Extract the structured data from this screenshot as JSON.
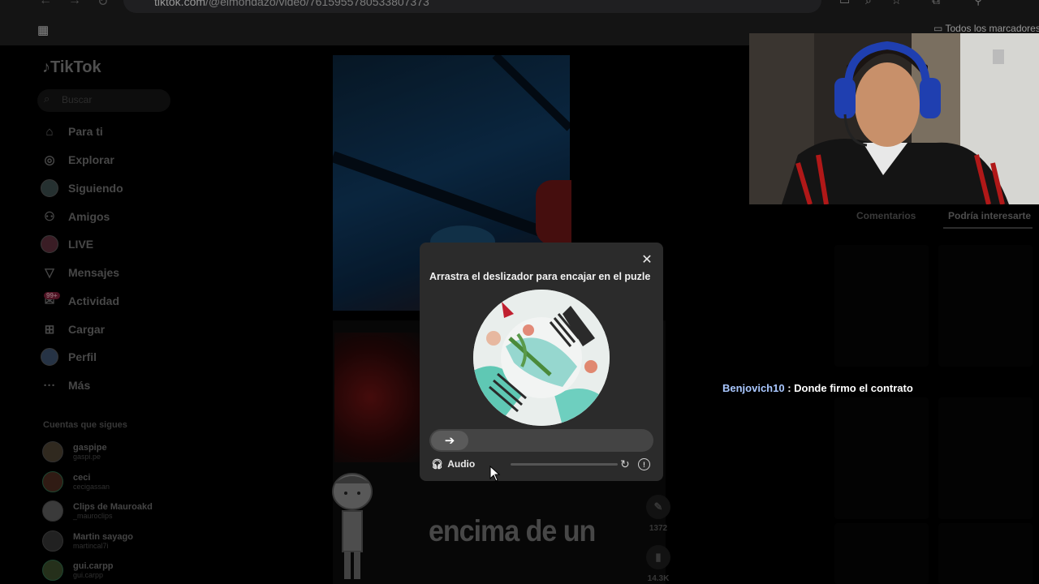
{
  "browser": {
    "url_host": "tiktok.com",
    "url_path": "/@elmondazo/video/7615955780533807373",
    "bookmarks_label": "Todos los marcadores"
  },
  "sidebar": {
    "logo": "TikTok",
    "search_placeholder": "Buscar",
    "items": [
      {
        "label": "Para ti",
        "icon": "home-icon"
      },
      {
        "label": "Explorar",
        "icon": "compass-icon"
      },
      {
        "label": "Siguiendo",
        "icon": "following-avatar"
      },
      {
        "label": "Amigos",
        "icon": "friends-icon"
      },
      {
        "label": "LIVE",
        "icon": "live-icon"
      },
      {
        "label": "Mensajes",
        "icon": "messages-icon"
      },
      {
        "label": "Actividad",
        "icon": "activity-icon"
      },
      {
        "label": "Cargar",
        "icon": "upload-icon"
      },
      {
        "label": "Perfil",
        "icon": "profile-avatar"
      },
      {
        "label": "Más",
        "icon": "more-icon"
      }
    ],
    "activity_badge": "99+",
    "following_title": "Cuentas que sigues",
    "accounts": [
      {
        "name": "gaspipe",
        "handle": "gaspi.pe"
      },
      {
        "name": "ceci",
        "handle": "cecigassan"
      },
      {
        "name": "Clips de Mauroakd",
        "handle": "_mauroclips"
      },
      {
        "name": "Martin sayago",
        "handle": "martincal7i"
      },
      {
        "name": "gui.carpp",
        "handle": "gui.carpp"
      }
    ]
  },
  "video": {
    "caption": "encima de un",
    "comments_count": "1372",
    "saves_count": "14.3K"
  },
  "right_panel": {
    "tab_comments": "Comentarios",
    "tab_maybe": "Podría interesarte"
  },
  "chat": {
    "user": "Benjovich10",
    "separator": " : ",
    "message": "Donde firmo el contrato"
  },
  "captcha": {
    "title": "Arrastra el deslizador para encajar en el puzle",
    "audio_label": "Audio",
    "close_icon": "close-icon",
    "handle_icon": "arrow-right-icon"
  }
}
